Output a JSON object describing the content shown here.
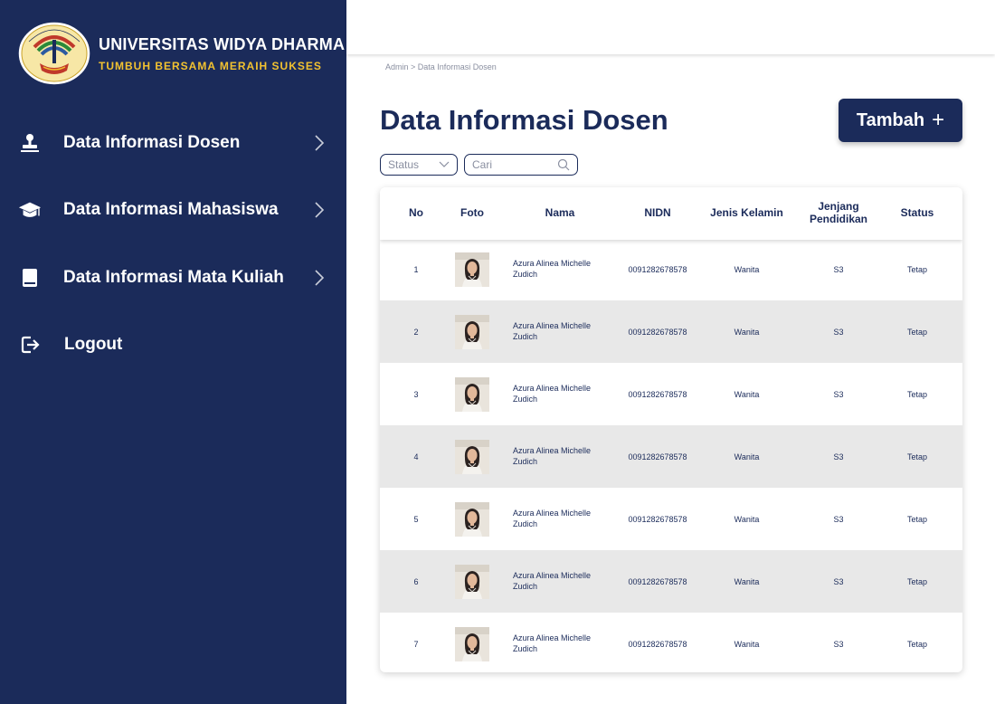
{
  "brand": {
    "title": "UNIVERSITAS WIDYA DHARMA",
    "subtitle": "TUMBUH BERSAMA MERAIH SUKSES"
  },
  "nav": {
    "items": [
      {
        "label": "Data Informasi Dosen",
        "icon": "lecturer-icon"
      },
      {
        "label": "Data Informasi Mahasiswa",
        "icon": "graduation-cap-icon"
      },
      {
        "label": "Data Informasi Mata Kuliah",
        "icon": "book-icon"
      },
      {
        "label": "Logout",
        "icon": "logout-icon"
      }
    ]
  },
  "breadcrumb": "Admin > Data Informasi Dosen",
  "page_title": "Data Informasi Dosen",
  "add_button": {
    "label": "Tambah",
    "icon": "plus-icon"
  },
  "filter": {
    "status_placeholder": "Status",
    "search_placeholder": "Cari"
  },
  "table": {
    "headers": {
      "no": "No",
      "foto": "Foto",
      "nama": "Nama",
      "nidn": "NIDN",
      "jenis_kelamin": "Jenis Kelamin",
      "jenjang": "Jenjang Pendidikan",
      "status": "Status"
    },
    "rows": [
      {
        "no": "1",
        "nama": "Azura Alinea Michelle Zudich",
        "nidn": "0091282678578",
        "jenis_kelamin": "Wanita",
        "jenjang": "S3",
        "status": "Tetap"
      },
      {
        "no": "2",
        "nama": "Azura Alinea Michelle Zudich",
        "nidn": "0091282678578",
        "jenis_kelamin": "Wanita",
        "jenjang": "S3",
        "status": "Tetap"
      },
      {
        "no": "3",
        "nama": "Azura Alinea Michelle Zudich",
        "nidn": "0091282678578",
        "jenis_kelamin": "Wanita",
        "jenjang": "S3",
        "status": "Tetap"
      },
      {
        "no": "4",
        "nama": "Azura Alinea Michelle Zudich",
        "nidn": "0091282678578",
        "jenis_kelamin": "Wanita",
        "jenjang": "S3",
        "status": "Tetap"
      },
      {
        "no": "5",
        "nama": "Azura Alinea Michelle Zudich",
        "nidn": "0091282678578",
        "jenis_kelamin": "Wanita",
        "jenjang": "S3",
        "status": "Tetap"
      },
      {
        "no": "6",
        "nama": "Azura Alinea Michelle Zudich",
        "nidn": "0091282678578",
        "jenis_kelamin": "Wanita",
        "jenjang": "S3",
        "status": "Tetap"
      },
      {
        "no": "7",
        "nama": "Azura Alinea Michelle Zudich",
        "nidn": "0091282678578",
        "jenis_kelamin": "Wanita",
        "jenjang": "S3",
        "status": "Tetap"
      }
    ]
  },
  "colors": {
    "primary": "#1b2b5a",
    "accent": "#f2c230",
    "row_alt": "#e8e8e8"
  }
}
